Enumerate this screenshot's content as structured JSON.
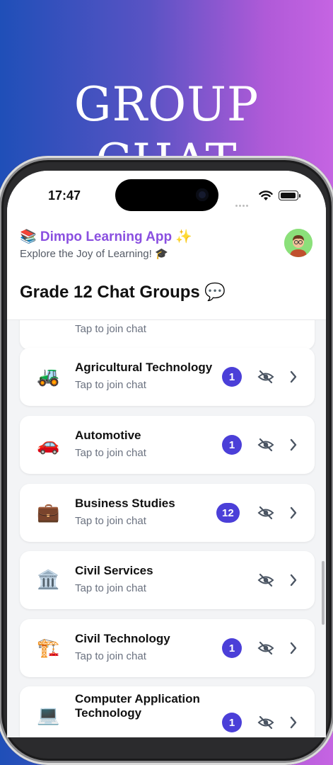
{
  "promo": {
    "title": "GROUP CHAT"
  },
  "status_bar": {
    "time": "17:47"
  },
  "header": {
    "app_name": "📚 Dimpo Learning App ✨",
    "tagline": "Explore the Joy of Learning! 🎓"
  },
  "page": {
    "title": "Grade 12 Chat Groups 💬"
  },
  "groups": [
    {
      "name": "",
      "subtitle": "Tap to join chat",
      "emoji": "",
      "unread": ""
    },
    {
      "name": "Agricultural Technology",
      "subtitle": "Tap to join chat",
      "emoji": "🚜",
      "unread": "1"
    },
    {
      "name": "Automotive",
      "subtitle": "Tap to join chat",
      "emoji": "🚗",
      "unread": "1"
    },
    {
      "name": "Business Studies",
      "subtitle": "Tap to join chat",
      "emoji": "💼",
      "unread": "12"
    },
    {
      "name": "Civil Services",
      "subtitle": "Tap to join chat",
      "emoji": "🏛️",
      "unread": ""
    },
    {
      "name": "Civil Technology",
      "subtitle": "Tap to join chat",
      "emoji": "🏗️",
      "unread": "1"
    },
    {
      "name": "Computer Application Technology",
      "subtitle": "",
      "emoji": "💻",
      "unread": "1"
    }
  ],
  "icons": {
    "eye": "eye-off-icon",
    "chevron": "chevron-right-icon"
  },
  "colors": {
    "accent": "#4b3fd8",
    "brand": "#8a4fe0"
  }
}
